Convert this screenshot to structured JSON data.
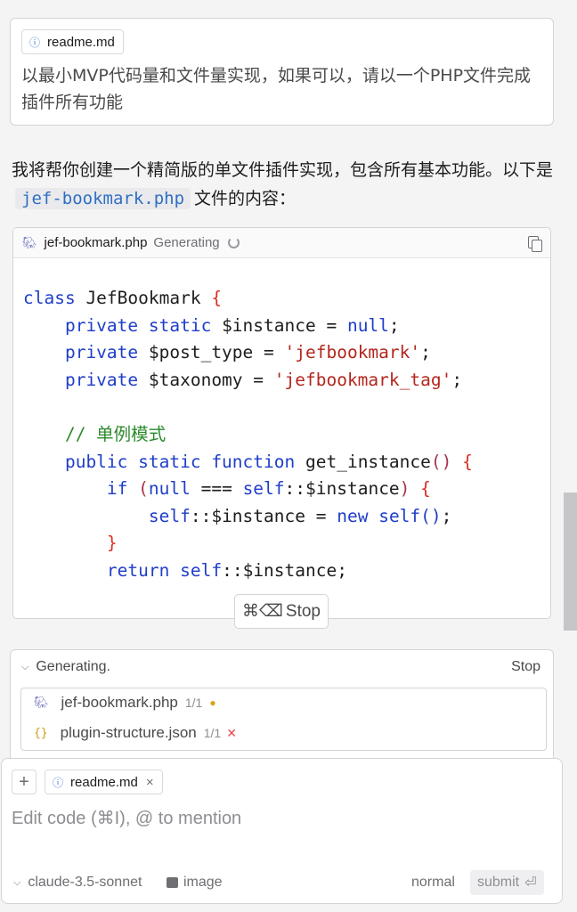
{
  "prompt": {
    "attachment": "readme.md",
    "text": "以最小MVP代码量和文件量实现，如果可以，请以一个PHP文件完成插件所有功能"
  },
  "reply": {
    "line1": "我将帮你创建一个精简版的单文件插件实现，包含所有基本功能。以下是",
    "code_name": "jef-bookmark.php",
    "line2": "文件的内容："
  },
  "code_block": {
    "filename": "jef-bookmark.php",
    "status": "Generating",
    "lines": {
      "l1a": "class",
      "l1b": " JefBookmark ",
      "l1c": "{",
      "l2a": "    private static",
      "l2b": " $instance = ",
      "l2c": "null",
      "l2d": ";",
      "l3a": "    private",
      "l3b": " $post_type = ",
      "l3c": "'jefbookmark'",
      "l3d": ";",
      "l4a": "    private",
      "l4b": " $taxonomy = ",
      "l4c": "'jefbookmark_tag'",
      "l4d": ";",
      "l6": "    // 单例模式",
      "l7a": "    public static function",
      "l7b": " get_instance",
      "l7c": "()",
      "l7d": " ",
      "l7e": "{",
      "l8a": "        if",
      "l8b": " (",
      "l8c": "null",
      "l8d": " === ",
      "l8e": "self",
      "l8f": "::$instance",
      "l8g": ")",
      "l8h": " ",
      "l8i": "{",
      "l9a": "            self",
      "l9b": "::$instance = ",
      "l9c": "new",
      "l9d": " ",
      "l9e": "self",
      "l9f": "()",
      "l9g": ";",
      "l10": "        }",
      "l11a": "        return",
      "l11b": " ",
      "l11c": "self",
      "l11d": "::$instance;"
    }
  },
  "stop_float": {
    "shortcut": "⌘⌫",
    "label": "Stop"
  },
  "generating_panel": {
    "title": "Generating.",
    "stop_label": "Stop",
    "files": [
      {
        "name": "jef-bookmark.php",
        "count": "1/1"
      },
      {
        "name": "plugin-structure.json",
        "count": "1/1"
      }
    ]
  },
  "composer": {
    "attachment": "readme.md",
    "placeholder": "Edit code (⌘I), @ to mention",
    "model": "claude-3.5-sonnet",
    "image_label": "image",
    "mode": "normal",
    "submit_label": "submit"
  },
  "icons": {
    "info": "info-icon",
    "php": "php-elephant-icon",
    "copy": "copy-icon",
    "spinner": "spinner-icon",
    "json": "json-braces-icon",
    "chevron": "chevron-down-icon",
    "close": "close-icon",
    "plus": "plus-icon",
    "image": "image-icon",
    "enter": "enter-icon"
  },
  "colors": {
    "keyword": "#1f3ec9",
    "string": "#b3261e",
    "comment": "#2c8a2c",
    "link_code": "#2f6fc4"
  }
}
